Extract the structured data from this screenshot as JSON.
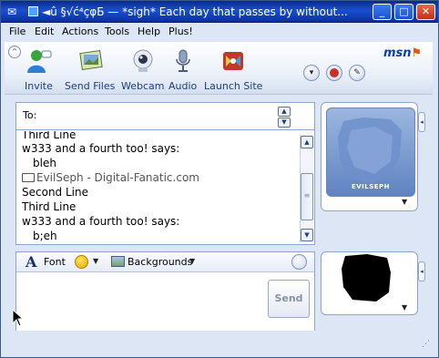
{
  "window": {
    "title": "◄û §√ć⁴çφБ — *sigh* Each day that passes by without..."
  },
  "titlebar_buttons": {
    "minimize": "_",
    "maximize": "□",
    "close": "✕"
  },
  "menu": {
    "items": [
      "File",
      "Edit",
      "Actions",
      "Tools",
      "Help",
      "Plus!"
    ]
  },
  "toolbar": {
    "items": [
      {
        "label": "Invite",
        "icon": "invite-icon"
      },
      {
        "label": "Send Files",
        "icon": "send-files-icon"
      },
      {
        "label": "Webcam",
        "icon": "webcam-icon"
      },
      {
        "label": "Audio",
        "icon": "audio-icon"
      },
      {
        "label": "Launch Site",
        "icon": "launch-site-icon"
      }
    ],
    "brand": "msn"
  },
  "conversation": {
    "to_label": "To:",
    "lines": [
      {
        "text": "Third Line",
        "kind": "message"
      },
      {
        "text": "w333 and a fourth too! says:",
        "kind": "header"
      },
      {
        "text": "bleh",
        "kind": "message-indent"
      },
      {
        "text": "EvilSeph - Digital-Fanatic.com",
        "kind": "nick"
      },
      {
        "text": "Second Line",
        "kind": "message"
      },
      {
        "text": "Third Line",
        "kind": "message"
      },
      {
        "text": "w333 and a fourth too! says:",
        "kind": "header"
      },
      {
        "text": "b;eh",
        "kind": "message-indent"
      }
    ]
  },
  "compose": {
    "font_label": "Font",
    "backgrounds_label": "Backgrounds",
    "input_value": "",
    "send_label": "Send"
  },
  "contact_avatar": {
    "caption": "EVILSEPH"
  },
  "colors": {
    "titlebar": "#1a4fd0",
    "window_bg": "#dce6f4",
    "panel_border": "#8da6c9"
  }
}
